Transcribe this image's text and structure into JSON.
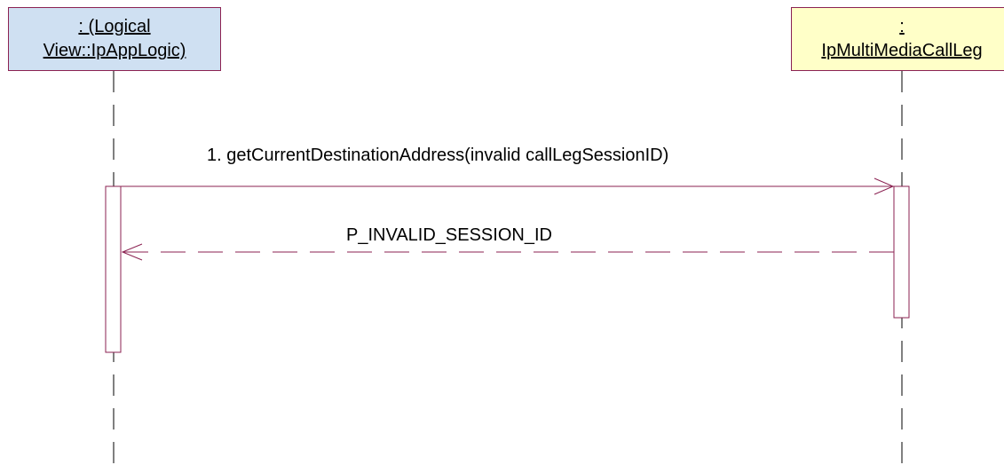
{
  "lifelines": [
    {
      "line1": ": (Logical",
      "line2": "View::IpAppLogic)",
      "fill": "#cfe0f2"
    },
    {
      "line1": ":",
      "line2": "IpMultiMediaCallLeg",
      "fill": "#ffffc8"
    }
  ],
  "messages": [
    {
      "label": "1. getCurrentDestinationAddress(invalid callLegSessionID)",
      "style": "solid",
      "direction": "left-to-right"
    },
    {
      "label": "P_INVALID_SESSION_ID",
      "style": "dashed",
      "direction": "right-to-left"
    }
  ],
  "colors": {
    "line": "#8b2252",
    "lifeline_dash": "#000000"
  }
}
